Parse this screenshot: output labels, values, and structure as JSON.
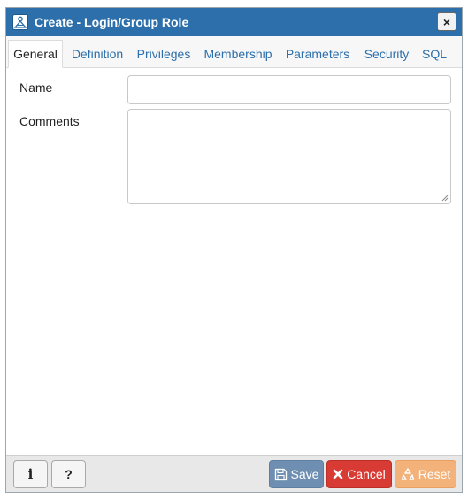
{
  "dialog": {
    "title": "Create - Login/Group Role",
    "close_label": "×"
  },
  "tabs": [
    {
      "label": "General",
      "active": true
    },
    {
      "label": "Definition",
      "active": false
    },
    {
      "label": "Privileges",
      "active": false
    },
    {
      "label": "Membership",
      "active": false
    },
    {
      "label": "Parameters",
      "active": false
    },
    {
      "label": "Security",
      "active": false
    },
    {
      "label": "SQL",
      "active": false
    }
  ],
  "form": {
    "name_label": "Name",
    "name_value": "",
    "comments_label": "Comments",
    "comments_value": ""
  },
  "footer": {
    "info_label": "i",
    "help_label": "?",
    "save_label": "Save",
    "cancel_label": "Cancel",
    "reset_label": "Reset"
  },
  "colors": {
    "titlebar": "#2c6fab",
    "save": "#6e8fb1",
    "cancel": "#d73b33",
    "reset": "#f3b27a"
  },
  "icons": {
    "title": "role-icon",
    "save": "floppy-disk-icon",
    "cancel": "x-icon",
    "reset": "recycle-icon"
  }
}
